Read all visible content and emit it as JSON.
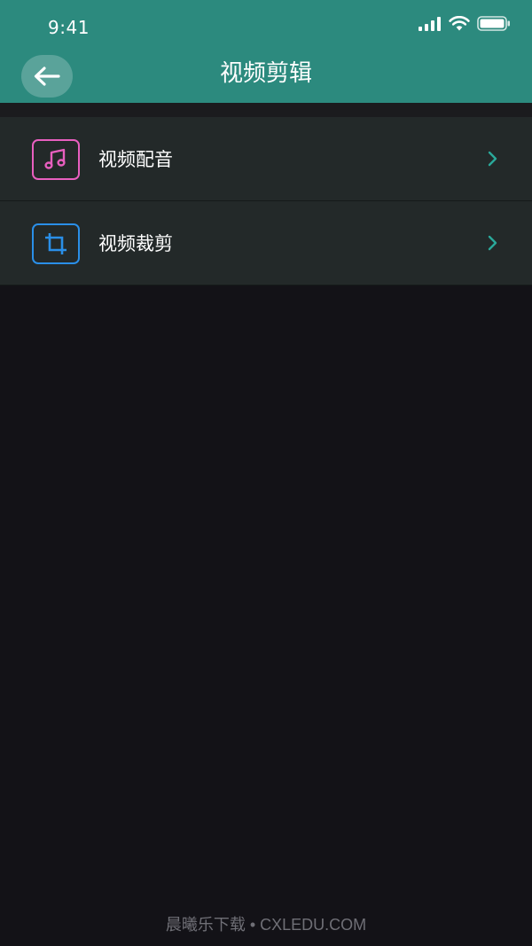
{
  "status_bar": {
    "time": "9:41"
  },
  "header": {
    "title": "视频剪辑",
    "back_icon": "arrow-left-icon"
  },
  "menu": {
    "items": [
      {
        "label": "视频配音",
        "icon": "music-note-icon",
        "icon_color": "#e85fbf"
      },
      {
        "label": "视频裁剪",
        "icon": "crop-icon",
        "icon_color": "#2a8fe8"
      }
    ]
  },
  "watermark": {
    "text": "晨曦乐下载 • CXLEDU.COM"
  },
  "colors": {
    "header_bg": "#2c8a7e",
    "page_bg": "#131217",
    "row_bg": "#232929",
    "chevron": "#2aa89a"
  }
}
